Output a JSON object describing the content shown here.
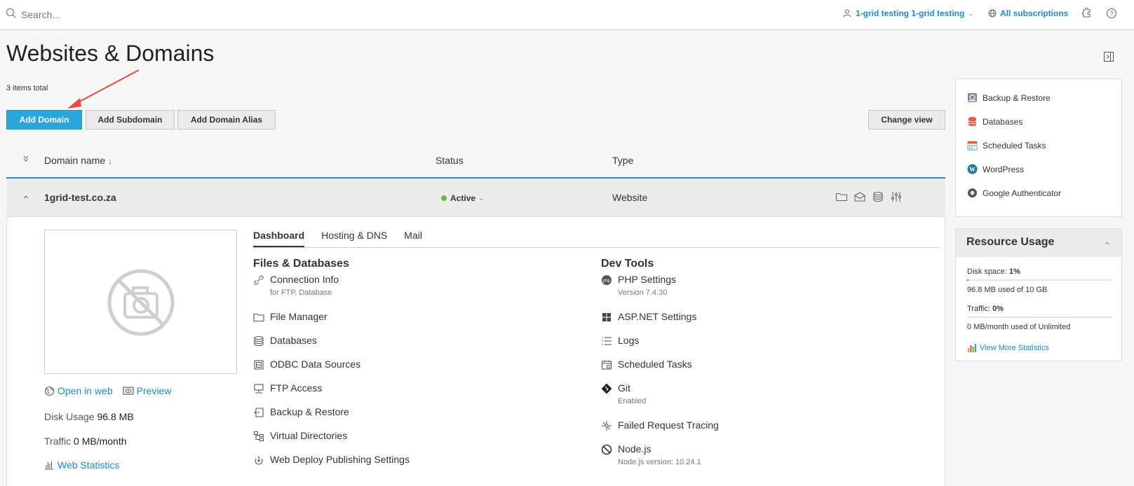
{
  "search": {
    "placeholder": "Search..."
  },
  "topbar": {
    "user_label": "1-grid testing 1-grid testing",
    "subscriptions_label": "All subscriptions"
  },
  "page": {
    "title": "Websites & Domains",
    "items_total": "3 items total"
  },
  "toolbar": {
    "add_domain": "Add Domain",
    "add_subdomain": "Add Subdomain",
    "add_domain_alias": "Add Domain Alias",
    "change_view": "Change view"
  },
  "table": {
    "columns": {
      "domain_name": "Domain name",
      "sort_indicator": "↓",
      "status": "Status",
      "type": "Type"
    },
    "rows": [
      {
        "domain": "1grid-test.co.za",
        "status": "Active",
        "type": "Website"
      }
    ]
  },
  "details": {
    "open_in_web": "Open in web",
    "preview": "Preview",
    "disk_usage_label": "Disk Usage",
    "disk_usage_value": "96.8 MB",
    "traffic_label": "Traffic",
    "traffic_value": "0 MB/month",
    "web_statistics": "Web Statistics",
    "tabs": [
      "Dashboard",
      "Hosting & DNS",
      "Mail"
    ],
    "files_title": "Files & Databases",
    "dev_title": "Dev Tools",
    "files_tools": [
      {
        "label": "Connection Info",
        "sub": "for FTP, Database"
      },
      {
        "label": "File Manager"
      },
      {
        "label": "Databases"
      },
      {
        "label": "ODBC Data Sources"
      },
      {
        "label": "FTP Access"
      },
      {
        "label": "Backup & Restore"
      },
      {
        "label": "Virtual Directories"
      },
      {
        "label": "Web Deploy Publishing Settings"
      }
    ],
    "dev_tools": [
      {
        "label": "PHP Settings",
        "sub": "Version 7.4.30"
      },
      {
        "label": "ASP.NET Settings"
      },
      {
        "label": "Logs"
      },
      {
        "label": "Scheduled Tasks"
      },
      {
        "label": "Git",
        "sub": "Enabled"
      },
      {
        "label": "Failed Request Tracing"
      },
      {
        "label": "Node.js",
        "sub": "Node.js version: 10.24.1"
      }
    ]
  },
  "sidebar": {
    "links": [
      "Backup & Restore",
      "Databases",
      "Scheduled Tasks",
      "WordPress",
      "Google Authenticator"
    ],
    "resource": {
      "title": "Resource Usage",
      "disk_label": "Disk space:",
      "disk_value": "1%",
      "disk_fraction": 0.01,
      "disk_detail": "96.8 MB used of 10 GB",
      "traffic_label": "Traffic:",
      "traffic_value": "0%",
      "traffic_fraction": 0,
      "traffic_detail": "0 MB/month used of Unlimited",
      "view_more": "View More Statistics"
    }
  },
  "colors": {
    "accent": "#2aa6dc",
    "link": "#1e88c7",
    "active": "#6cb33e",
    "annotation": "#e74c3c"
  }
}
